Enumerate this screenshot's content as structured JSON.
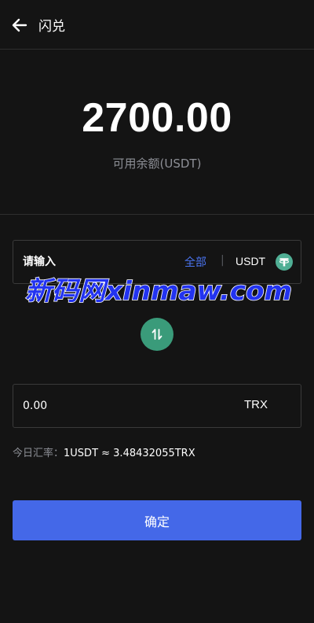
{
  "header": {
    "title": "闪兑",
    "back_icon": "arrow-left-icon"
  },
  "balance": {
    "amount": "2700.00",
    "label": "可用余额(USDT)"
  },
  "from": {
    "placeholder": "请输入",
    "all_label": "全部",
    "separator": "|",
    "unit": "USDT",
    "icon": "tether-icon",
    "icon_color": "#50af95"
  },
  "swap": {
    "icon": "swap-arrows-icon",
    "color": "#3a9b7a"
  },
  "to": {
    "value": "0.00",
    "unit": "TRX"
  },
  "rate": {
    "label": "今日汇率：",
    "value": "1USDT ≈ 3.48432055TRX"
  },
  "confirm": {
    "label": "确定",
    "color": "#4468e8"
  },
  "watermark": {
    "text": "新码网xinmaw.com"
  },
  "colors": {
    "background": "#141414",
    "accent": "#4a74f0",
    "muted_text": "#8d8f96"
  }
}
